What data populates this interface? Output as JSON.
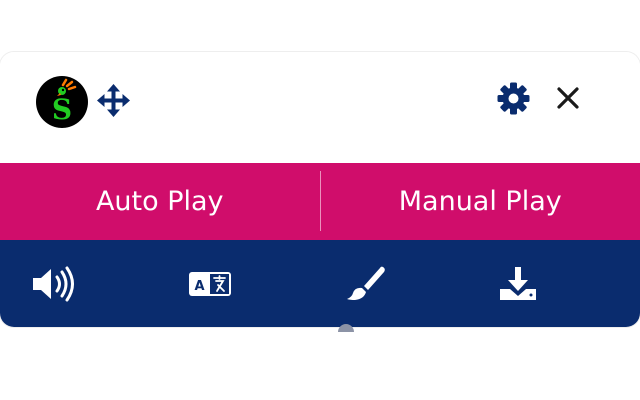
{
  "header": {
    "logo_letter": "S",
    "icons": {
      "logo": "parrot-logo-icon",
      "move": "move-arrows-icon",
      "settings": "gear-icon",
      "close": "close-icon"
    }
  },
  "play_modes": {
    "auto_label": "Auto Play",
    "manual_label": "Manual Play"
  },
  "tools": [
    {
      "icon": "volume-icon"
    },
    {
      "icon": "translate-icon"
    },
    {
      "icon": "paint-brush-icon"
    },
    {
      "icon": "download-icon"
    }
  ],
  "colors": {
    "accent_pink": "#d00d6b",
    "toolbar_navy": "#0a2c6e",
    "icon_navy": "#0a2c6e",
    "logo_green": "#22cc22",
    "logo_orange": "#ff7a00"
  }
}
